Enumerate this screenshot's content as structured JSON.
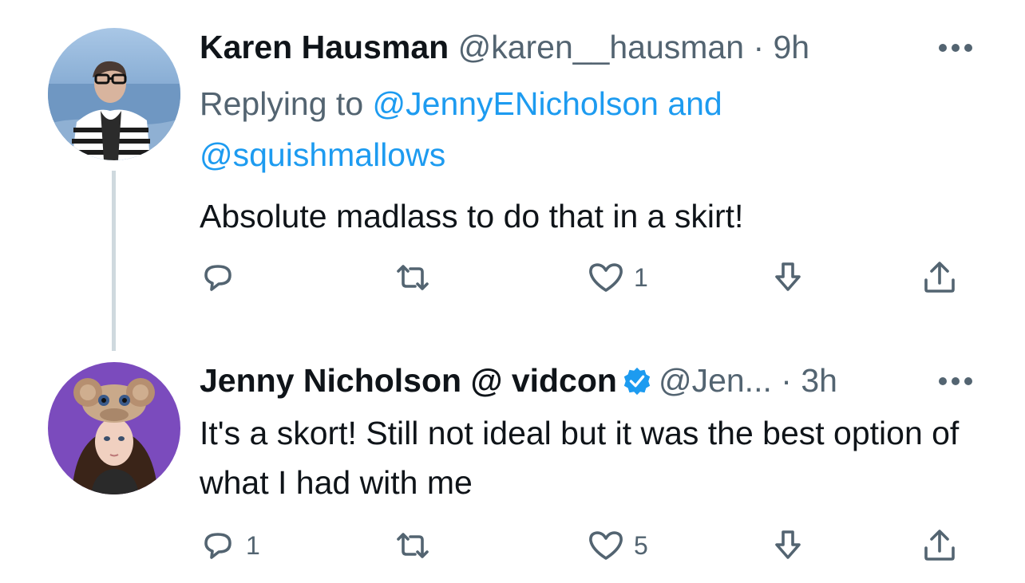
{
  "tweets": [
    {
      "name": "Karen Hausman",
      "handle": "@karen__hausman",
      "dot": "·",
      "time": "9h",
      "replying_prefix": "Replying to ",
      "mention_1": "@JennyENicholson",
      "mention_and": " and",
      "mention_2": "@squishmallows",
      "text": "Absolute madlass to do that in a skirt!",
      "reply_count": "",
      "retweet_count": "",
      "like_count": "1"
    },
    {
      "name": "Jenny Nicholson @ vidcon",
      "handle": "@Jen...",
      "dot": "·",
      "time": "3h",
      "text": "It's a skort! Still not ideal but it was the best option of what I had with me",
      "reply_count": "1",
      "retweet_count": "",
      "like_count": "5"
    }
  ],
  "icons": {
    "more": "more-horizontal-icon",
    "reply": "reply-bubble-icon",
    "retweet": "retweet-icon",
    "like": "heart-icon",
    "bookmark": "download-arrow-icon",
    "share": "share-upload-icon",
    "verified": "verified-badge-icon"
  },
  "colors": {
    "text": "#0f1419",
    "secondary": "#536471",
    "link": "#1d9bf0",
    "thread_line": "#cfd9de"
  }
}
